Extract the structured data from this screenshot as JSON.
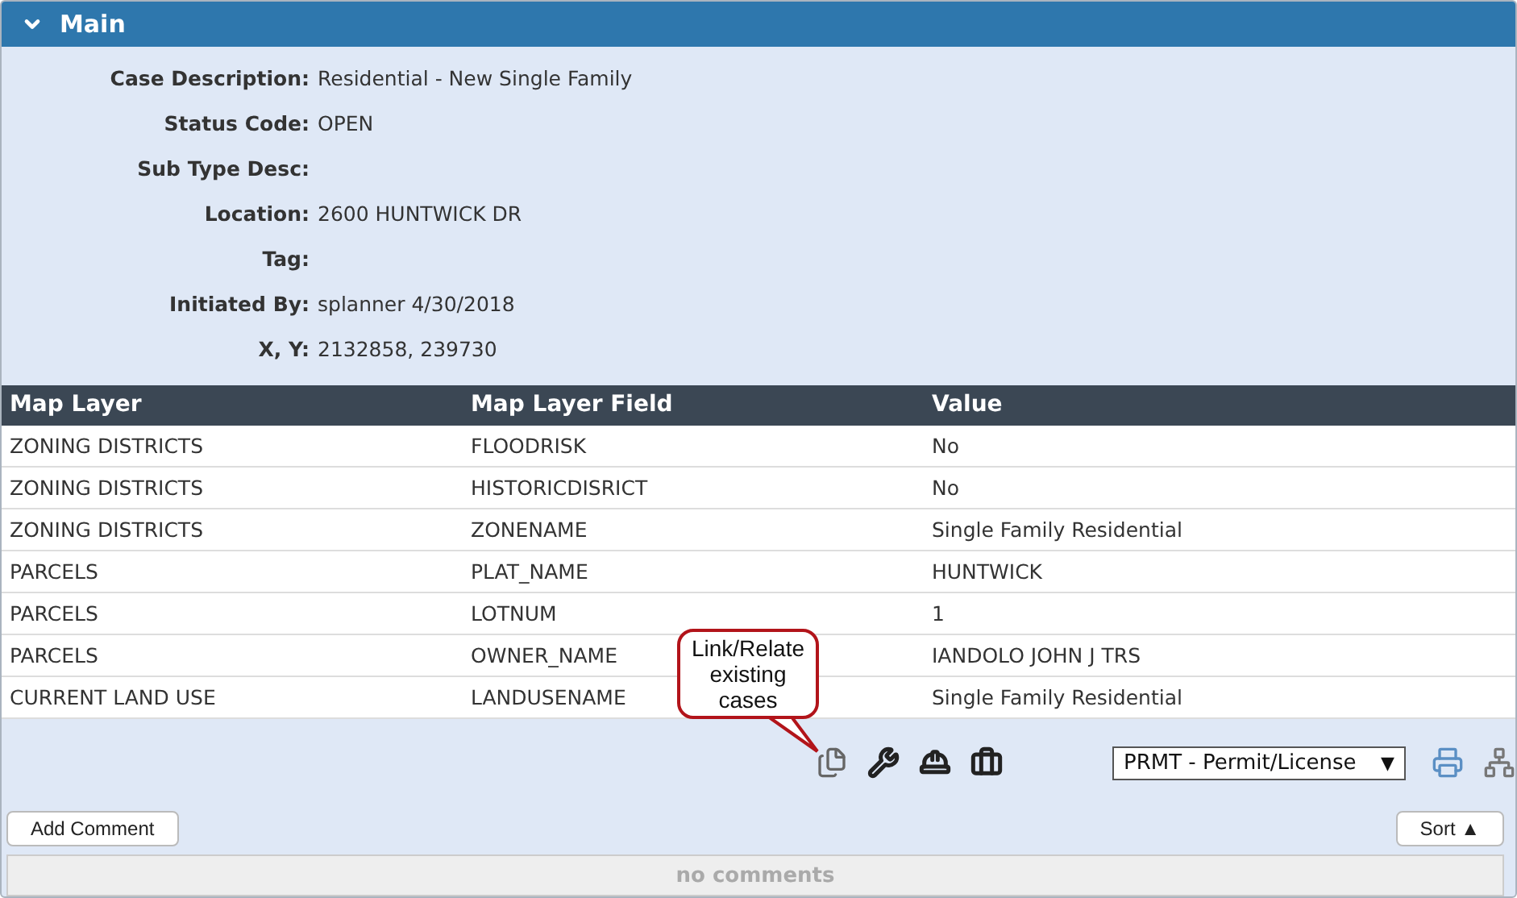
{
  "panel": {
    "title": "Main",
    "expanded": true
  },
  "fields": [
    {
      "label": "Case Description:",
      "value": "Residential - New Single Family"
    },
    {
      "label": "Status Code:",
      "value": "OPEN"
    },
    {
      "label": "Sub Type Desc:"
    },
    {
      "label": "Location:",
      "value": "2600 HUNTWICK DR"
    },
    {
      "label": "Tag:"
    },
    {
      "label": "Initiated By:",
      "value": "splanner 4/30/2018"
    },
    {
      "label": "X, Y:",
      "value": "2132858, 239730"
    }
  ],
  "table": {
    "columns": [
      "Map Layer",
      "Map Layer Field",
      "Value"
    ],
    "rows": [
      [
        "ZONING DISTRICTS",
        "FLOODRISK",
        "No"
      ],
      [
        "ZONING DISTRICTS",
        "HISTORICDISRICT",
        "No"
      ],
      [
        "ZONING DISTRICTS",
        "ZONENAME",
        "Single Family Residential"
      ],
      [
        "PARCELS",
        "PLAT_NAME",
        "HUNTWICK"
      ],
      [
        "PARCELS",
        "LOTNUM",
        "1"
      ],
      [
        "PARCELS",
        "OWNER_NAME",
        "IANDOLO JOHN J TRS"
      ],
      [
        "CURRENT LAND USE",
        "LANDUSENAME",
        "Single Family Residential"
      ]
    ]
  },
  "callout": {
    "text": "Link/Relate existing cases"
  },
  "toolbar": {
    "case_type": "PRMT - Permit/License",
    "caret": "▼"
  },
  "comments": {
    "add_button": "Add Comment",
    "sort_button": "Sort ▲",
    "empty_text": "no comments"
  }
}
